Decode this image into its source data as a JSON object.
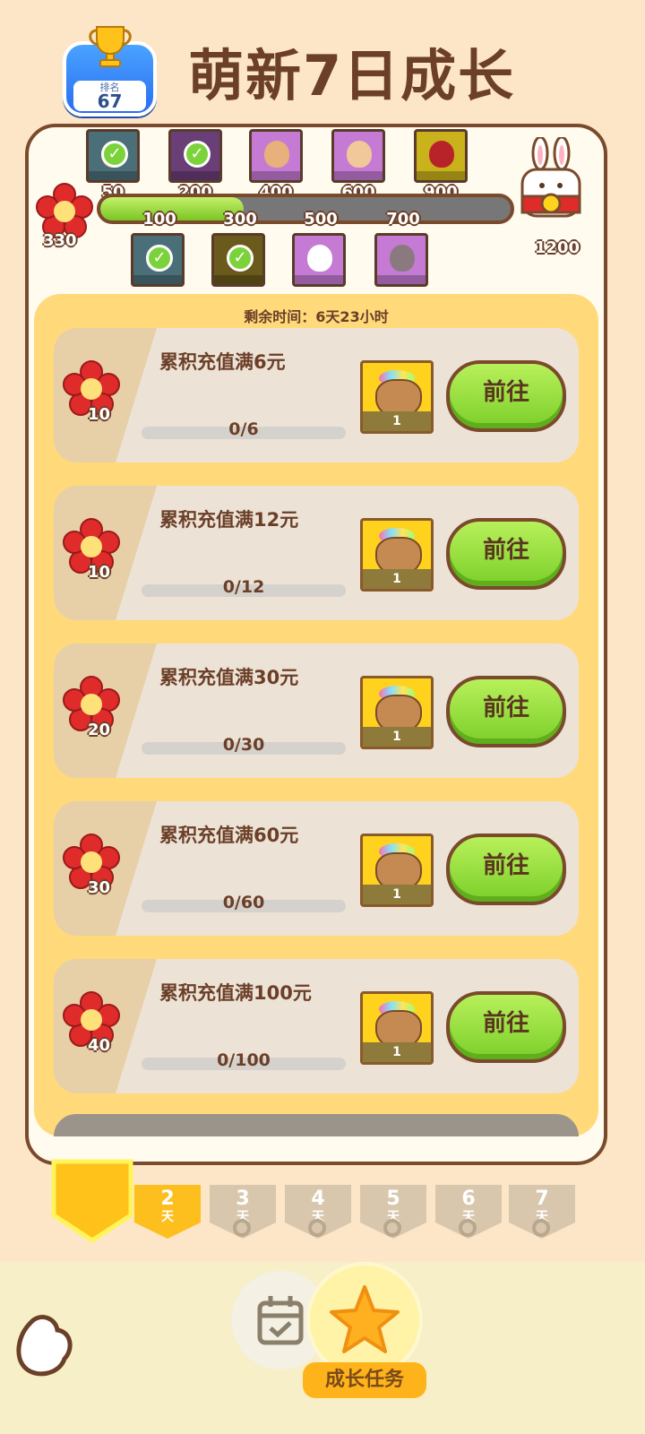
{
  "header": {
    "rank_label": "排名",
    "rank_value": "67",
    "title": "萌新7日成长"
  },
  "milestones": {
    "flower_count": "330",
    "top_row": [
      {
        "label": "50",
        "claimed": true,
        "color": "#4b6f78"
      },
      {
        "label": "200",
        "claimed": true,
        "color": "#6a3f78"
      },
      {
        "label": "400",
        "claimed": false,
        "color": "#c57bd4"
      },
      {
        "label": "600",
        "claimed": false,
        "color": "#c57bd4"
      },
      {
        "label": "900",
        "claimed": false,
        "color": "#c9b21c"
      }
    ],
    "bottom_row": [
      {
        "label": "100",
        "claimed": true,
        "color": "#4b6f78"
      },
      {
        "label": "300",
        "claimed": true,
        "color": "#6a5a1c"
      },
      {
        "label": "500",
        "claimed": false,
        "color": "#c57bd4"
      },
      {
        "label": "700",
        "claimed": false,
        "color": "#c57bd4"
      }
    ],
    "final_reward": "1200",
    "progress_fraction": 0.35
  },
  "tasks": {
    "remaining_time": "剩余时间：6天23小时",
    "button_label": "前往",
    "items": [
      {
        "title": "累积充值满6元",
        "progress": "0/6",
        "points": "10",
        "reward_count": "1"
      },
      {
        "title": "累积充值满12元",
        "progress": "0/12",
        "points": "10",
        "reward_count": "1"
      },
      {
        "title": "累积充值满30元",
        "progress": "0/30",
        "points": "20",
        "reward_count": "1"
      },
      {
        "title": "累积充值满60元",
        "progress": "0/60",
        "points": "30",
        "reward_count": "1"
      },
      {
        "title": "累积充值满100元",
        "progress": "0/100",
        "points": "40",
        "reward_count": "1"
      }
    ]
  },
  "days": {
    "current_day_num": "2",
    "day_suffix": "天",
    "locked": [
      {
        "num": "3",
        "suffix": "天"
      },
      {
        "num": "4",
        "suffix": "天"
      },
      {
        "num": "5",
        "suffix": "天"
      },
      {
        "num": "6",
        "suffix": "天"
      },
      {
        "num": "7",
        "suffix": "天"
      }
    ]
  },
  "bottom_nav": {
    "active_tab_label": "成长任务",
    "icons": [
      "home-icon",
      "calendar-check-icon",
      "star-icon"
    ]
  },
  "colors": {
    "background": "#fde6c7",
    "accent_green": "#7bcf2a",
    "accent_yellow": "#ffd97a",
    "brown": "#6b3f28",
    "flower_red": "#e02b2b"
  }
}
